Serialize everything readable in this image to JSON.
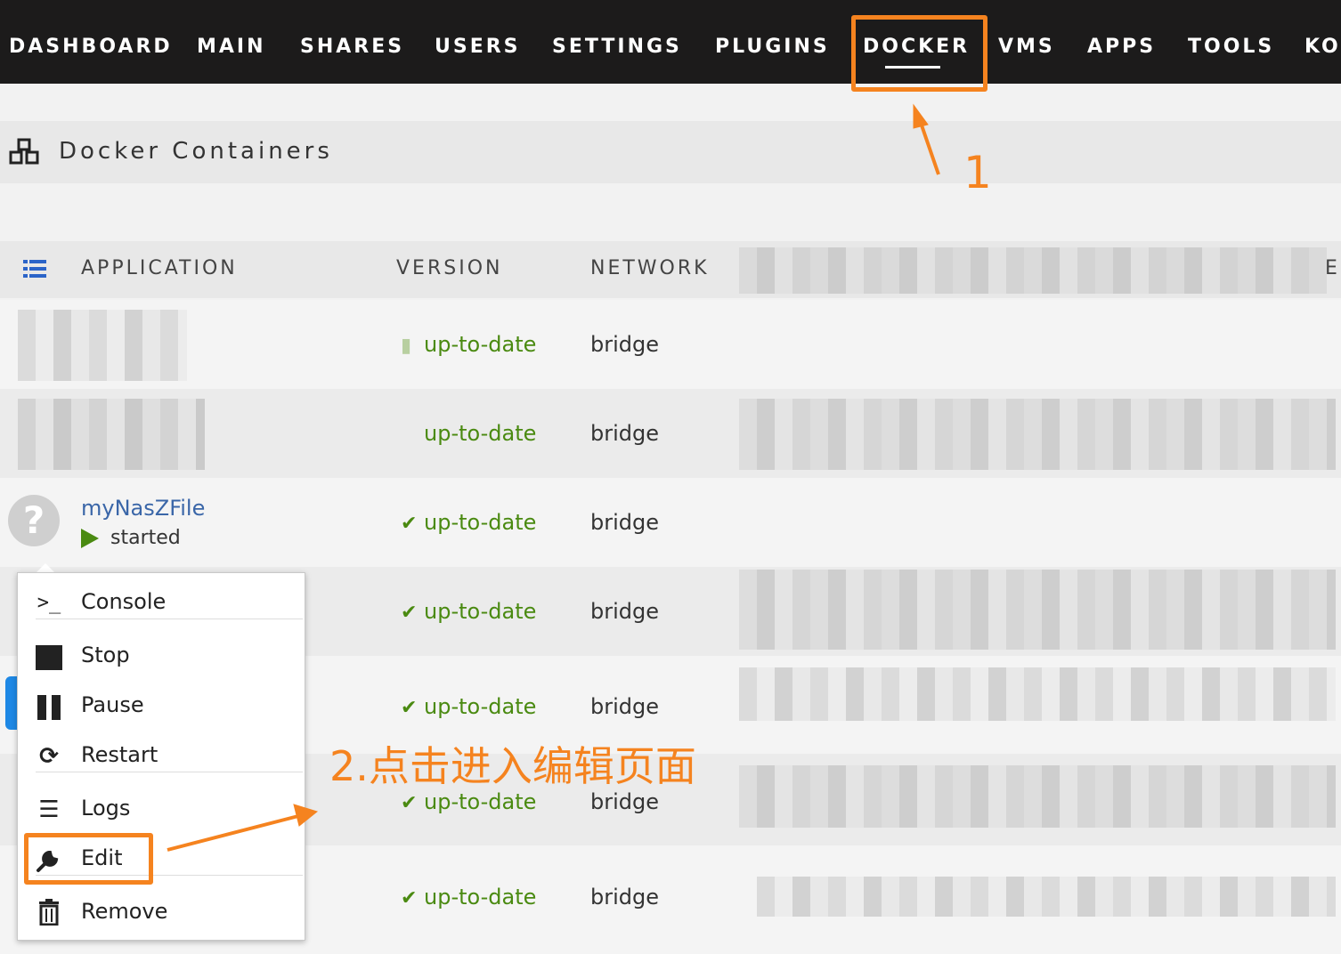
{
  "nav": {
    "items": [
      "DASHBOARD",
      "MAIN",
      "SHARES",
      "USERS",
      "SETTINGS",
      "PLUGINS",
      "DOCKER",
      "VMS",
      "APPS",
      "TOOLS",
      "KO"
    ],
    "active": "DOCKER"
  },
  "section": {
    "title": "Docker Containers"
  },
  "table": {
    "headers": {
      "application": "APPLICATION",
      "version": "VERSION",
      "network": "NETWORK",
      "extra": "E"
    },
    "rows": [
      {
        "version": "up-to-date",
        "network": "bridge"
      },
      {
        "version": "up-to-date",
        "network": "bridge"
      },
      {
        "name": "myNasZFile",
        "status": "started",
        "version": "up-to-date",
        "network": "bridge"
      },
      {
        "version": "up-to-date",
        "network": "bridge"
      },
      {
        "version": "up-to-date",
        "network": "bridge"
      },
      {
        "version": "up-to-date",
        "network": "bridge"
      },
      {
        "version": "up-to-date",
        "network": "bridge"
      }
    ]
  },
  "context_menu": {
    "items": [
      {
        "label": "Console",
        "icon": "terminal-icon"
      },
      {
        "label": "Stop",
        "icon": "stop-icon"
      },
      {
        "label": "Pause",
        "icon": "pause-icon"
      },
      {
        "label": "Restart",
        "icon": "restart-icon"
      },
      {
        "label": "Logs",
        "icon": "logs-icon"
      },
      {
        "label": "Edit",
        "icon": "wrench-icon"
      },
      {
        "label": "Remove",
        "icon": "trash-icon"
      }
    ]
  },
  "annotations": {
    "step1": "1",
    "step2": "2.点击进入编辑页面",
    "color": "#f5831f"
  },
  "colors": {
    "nav_bg": "#1c1b1b",
    "status_green": "#4a8a11",
    "link_blue": "#3a66a8"
  }
}
